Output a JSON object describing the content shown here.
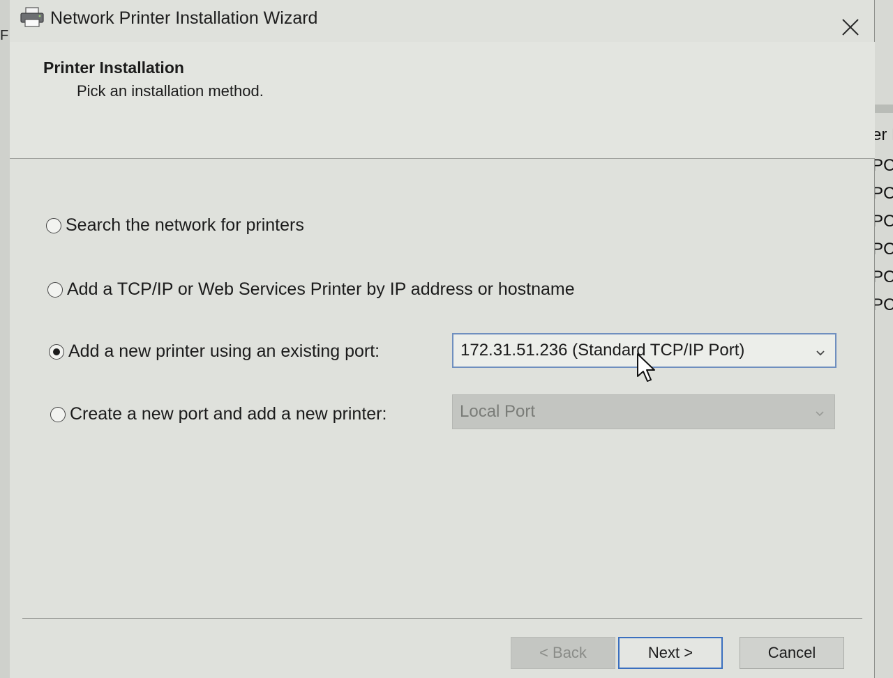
{
  "window": {
    "title": "Network Printer Installation Wizard",
    "close_icon": "close-icon"
  },
  "header": {
    "title": "Printer Installation",
    "subtitle": "Pick an installation method."
  },
  "options": [
    {
      "label": "Search the network for printers",
      "selected": false
    },
    {
      "label": "Add a TCP/IP or Web Services Printer by IP address or hostname",
      "selected": false
    },
    {
      "label": "Add a new printer using an existing port:",
      "selected": true
    },
    {
      "label": "Create a new port and add a new printer:",
      "selected": false
    }
  ],
  "existing_port_select": {
    "value": "172.31.51.236 (Standard TCP/IP Port)",
    "enabled": true
  },
  "new_port_select": {
    "value": "Local Port",
    "enabled": false
  },
  "buttons": {
    "back": "< Back",
    "next": "Next >",
    "cancel": "Cancel"
  },
  "background_window": {
    "left_fragment": "F",
    "right_fragments": [
      "er N",
      "PC (",
      "PC (",
      "PC (",
      "PC (",
      "PC (",
      "PC ("
    ]
  },
  "colors": {
    "accent": "#3a6fbf",
    "dialog_bg": "#dfe1dc"
  }
}
